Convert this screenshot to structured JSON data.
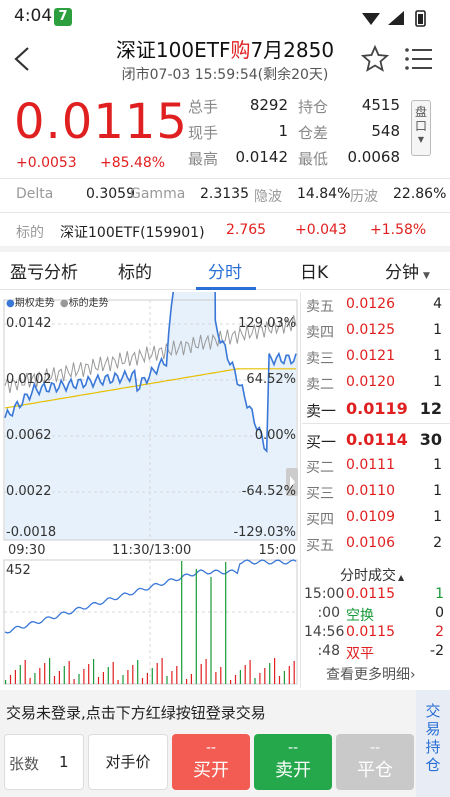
{
  "status_bar": {
    "time": "4:04",
    "app_badge": "7"
  },
  "header": {
    "title_pre": "深证100ETF",
    "title_mid": "购",
    "title_post": "7月2850",
    "subtitle": "闭市07-03  15:59:54(剩余20天)"
  },
  "quote": {
    "price": "0.0115",
    "change": "+0.0053",
    "change_pct": "+85.48%",
    "fields": [
      {
        "label": "总手",
        "value": "8292",
        "label2": "持仓",
        "value2": "4515"
      },
      {
        "label": "现手",
        "value": "1",
        "label2": "仓差",
        "value2": "548"
      },
      {
        "label": "最高",
        "value": "0.0142",
        "label2": "最低",
        "value2": "0.0068"
      }
    ],
    "disk_label": "盘口"
  },
  "greeks": {
    "delta_label": "Delta",
    "delta": "0.3059",
    "gamma_label": "Gamma",
    "gamma": "2.3135",
    "iv_label": "隐波",
    "iv": "14.84%",
    "hv_label": "历波",
    "hv": "22.86%"
  },
  "underlying": {
    "label": "标的",
    "name": "深证100ETF(159901)",
    "price": "2.765",
    "change": "+0.043",
    "change_pct": "+1.58%"
  },
  "tabs": [
    "盈亏分析",
    "标的",
    "分时",
    "日K",
    "分钟"
  ],
  "chart": {
    "legend_option": "期权走势",
    "legend_underlying": "标的走势",
    "y_left": [
      "0.0142",
      "0.0102",
      "0.0062",
      "0.0022",
      "-0.0018"
    ],
    "y_right": [
      "129.03%",
      "64.52%",
      "0.00%",
      "-64.52%",
      "-129.03%"
    ],
    "x_labels": [
      "09:30",
      "11:30/13:00",
      "15:00"
    ],
    "volume_max": "452"
  },
  "order_book": {
    "asks": [
      {
        "label": "卖五",
        "price": "0.0126",
        "vol": "4"
      },
      {
        "label": "卖四",
        "price": "0.0125",
        "vol": "1"
      },
      {
        "label": "卖三",
        "price": "0.0121",
        "vol": "1"
      },
      {
        "label": "卖二",
        "price": "0.0120",
        "vol": "1"
      },
      {
        "label": "卖一",
        "price": "0.0119",
        "vol": "12"
      }
    ],
    "bids": [
      {
        "label": "买一",
        "price": "0.0114",
        "vol": "30"
      },
      {
        "label": "买二",
        "price": "0.0111",
        "vol": "1"
      },
      {
        "label": "买三",
        "price": "0.0110",
        "vol": "1"
      },
      {
        "label": "买四",
        "price": "0.0109",
        "vol": "1"
      },
      {
        "label": "买五",
        "price": "0.0106",
        "vol": "2"
      }
    ]
  },
  "trades": {
    "title": "分时成交",
    "rows": [
      {
        "time": "15:00",
        "price": "0.0115",
        "vol": "1",
        "price_color": "red",
        "vol_color": "grn"
      },
      {
        "time": ":00",
        "price": "空换",
        "vol": "0",
        "price_color": "grn",
        "vol_color": "dark"
      },
      {
        "time": "14:56",
        "price": "0.0115",
        "vol": "2",
        "price_color": "red",
        "vol_color": "red"
      },
      {
        "time": ":48",
        "price": "双平",
        "vol": "-2",
        "price_color": "red",
        "vol_color": "dark"
      }
    ],
    "more": "查看更多明细›"
  },
  "login_notice": "交易未登录,点击下方红绿按钮登录交易",
  "side_label": "交易持仓",
  "qty_label": "张数",
  "qty_value": "1",
  "counter_price": "对手价",
  "buttons": [
    {
      "dash": "--",
      "label": "买开"
    },
    {
      "dash": "--",
      "label": "卖开"
    },
    {
      "dash": "--",
      "label": "平仓"
    }
  ]
}
